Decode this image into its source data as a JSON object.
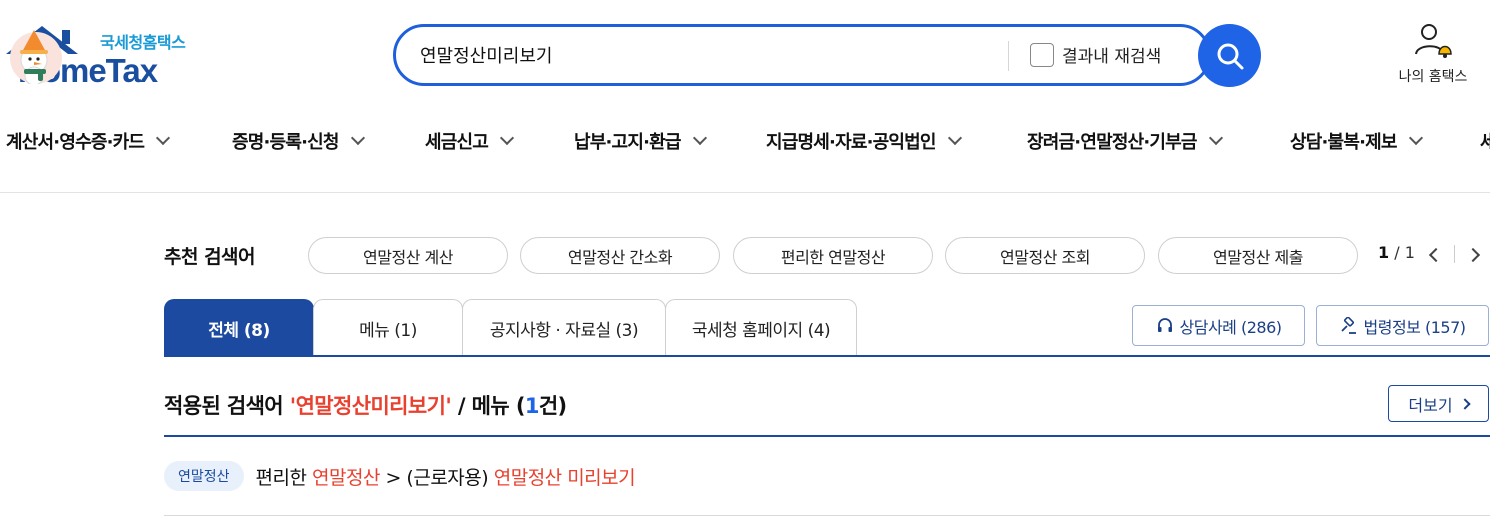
{
  "header": {
    "logo_sub": "국세청홈택스",
    "logo_main": "HomeTax",
    "search_value": "연말정산미리보기",
    "recheck_label": "결과내 재검색",
    "my_hometax": "나의 홈택스"
  },
  "gnb": [
    {
      "label": "계산서·영수증·카드"
    },
    {
      "label": "증명·등록·신청"
    },
    {
      "label": "세금신고"
    },
    {
      "label": "납부·고지·환급"
    },
    {
      "label": "지급명세·자료·공익법인"
    },
    {
      "label": "장려금·연말정산·기부금"
    },
    {
      "label": "상담·불복·제보"
    },
    {
      "label": "세"
    }
  ],
  "recommend": {
    "title": "추천 검색어",
    "chips": [
      "연말정산 계산",
      "연말정산 간소화",
      "편리한 연말정산",
      "연말정산 조회",
      "연말정산 제출"
    ],
    "page_current": "1",
    "page_total": "/ 1"
  },
  "tabs": [
    {
      "label": "전체 (8)",
      "active": true
    },
    {
      "label": "메뉴 (1)",
      "active": false
    },
    {
      "label": "공지사항 · 자료실 (3)",
      "active": false
    },
    {
      "label": "국세청 홈페이지 (4)",
      "active": false
    }
  ],
  "side_buttons": {
    "consult": "상담사례 (286)",
    "law": "법령정보 (157)"
  },
  "result": {
    "prefix": "적용된 검색어 ",
    "keyword": "'연말정산미리보기'",
    "middle": " / 메뉴 (",
    "count": "1",
    "suffix": "건)",
    "more_label": "더보기"
  },
  "rows": [
    {
      "tag": "연말정산",
      "part1": "편리한 ",
      "hl1": "연말정산",
      "part2": " > (근로자용) ",
      "hl2": "연말정산 미리보기"
    }
  ],
  "colors": {
    "brand": "#1b4aa0",
    "search_accent": "#1f63e6",
    "highlight": "#e8412f"
  }
}
